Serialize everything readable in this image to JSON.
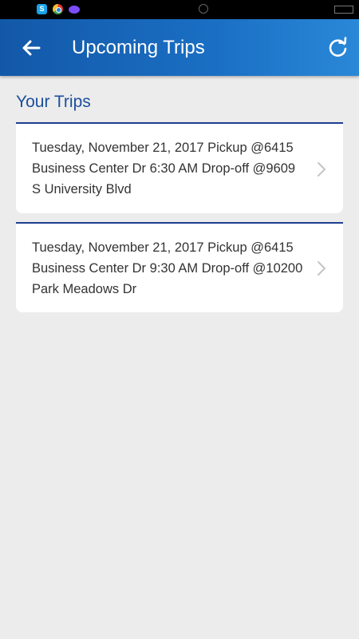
{
  "header": {
    "title": "Upcoming Trips"
  },
  "section": {
    "title": "Your Trips"
  },
  "trips": [
    {
      "text": "Tuesday, November 21, 2017 Pickup @6415 Business Center Dr 6:30 AM Drop-off @9609 S University Blvd"
    },
    {
      "text": "Tuesday, November 21, 2017 Pickup @6415 Business Center Dr 9:30 AM Drop-off @10200 Park Meadows Dr"
    }
  ],
  "icons": {
    "back": "arrow-left-icon",
    "refresh": "refresh-icon",
    "chevron": "chevron-right-icon"
  },
  "colors": {
    "app_bar": "#1a6fc4",
    "accent": "#1b4f9c",
    "background": "#ececec"
  }
}
